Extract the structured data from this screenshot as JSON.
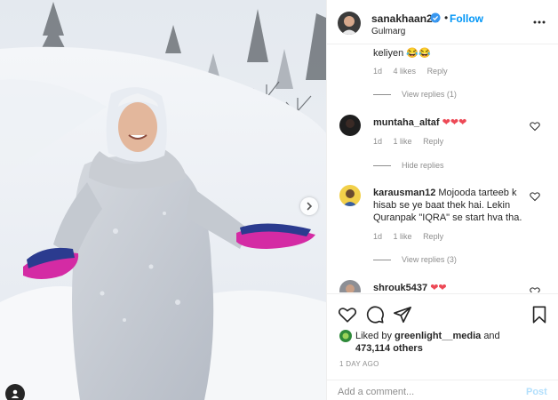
{
  "post": {
    "author": "sanakhaan21",
    "follow_label": "Follow",
    "separator": "•",
    "location": "Gulmarg"
  },
  "icons": {
    "verified": "verified-badge-icon",
    "more": "more-options-icon",
    "carousel_next": "chevron-right-icon",
    "tag": "user-tag-icon",
    "like": "heart-icon",
    "comment": "comment-icon",
    "share": "paper-plane-icon",
    "save": "bookmark-icon"
  },
  "colors": {
    "accent": "#0095f6",
    "like_red": "#ed4956",
    "muted": "#8e8e8e"
  },
  "comments": [
    {
      "text": "keliyen 😂😂",
      "age": "1d",
      "likes": "4 likes",
      "reply_label": "Reply",
      "replies_toggle": "View replies (1)"
    },
    {
      "user": "muntaha_altaf",
      "text": "❤❤❤",
      "age": "1d",
      "likes": "1 like",
      "reply_label": "Reply",
      "replies_toggle": "Hide replies"
    },
    {
      "user": "karausman12",
      "text": "Mojooda tarteeb k hisab se ye baat thek hai. Lekin Quranpak \"IQRA\" se start hva tha.",
      "age": "1d",
      "likes": "1 like",
      "reply_label": "Reply",
      "replies_toggle": "View replies (3)"
    },
    {
      "user": "shrouk5437",
      "text": "❤❤"
    }
  ],
  "likes": {
    "prefix": "Liked by",
    "by_user": "greenlight__media",
    "and": "and",
    "others": "473,114 others"
  },
  "time_ago": "1 DAY AGO",
  "add_comment": {
    "placeholder": "Add a comment...",
    "post_label": "Post"
  }
}
